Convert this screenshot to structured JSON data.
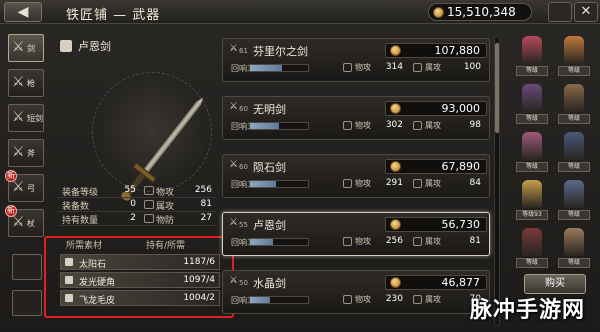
{
  "header": {
    "back_label": "◀",
    "title": "铁匠铺 — 武器",
    "money": "15,510,348",
    "close_label": "✕"
  },
  "tabs": [
    {
      "label": "剑",
      "icon": "sword-icon",
      "active": true
    },
    {
      "label": "枪",
      "icon": "spear-icon"
    },
    {
      "label": "短剑",
      "icon": "dagger-icon"
    },
    {
      "label": "斧",
      "icon": "axe-icon"
    },
    {
      "label": "弓",
      "icon": "bow-icon",
      "badge": "新"
    },
    {
      "label": "杖",
      "icon": "staff-icon",
      "badge": "新"
    }
  ],
  "detail": {
    "weapon_name": "卢恩剑",
    "stats": [
      {
        "label": "装备等级",
        "value": "55",
        "label2": "物攻",
        "value2": "256"
      },
      {
        "label": "装备数",
        "value": "0",
        "label2": "属攻",
        "value2": "81"
      },
      {
        "label": "持有数量",
        "value": "2",
        "label2": "物防",
        "value2": "27"
      }
    ],
    "materials_header": [
      "所需素材",
      "持有/所需"
    ],
    "materials": [
      {
        "name": "太阳石",
        "qty": "1187/6"
      },
      {
        "name": "发光硬角",
        "qty": "1097/4"
      },
      {
        "name": "飞龙毛皮",
        "qty": "1004/2"
      }
    ]
  },
  "weapons": [
    {
      "level": "61",
      "name": "芬里尔之剑",
      "price": "107,880",
      "rate_label": "回响3",
      "rate": 0.55,
      "atk": "314",
      "elem": "100"
    },
    {
      "level": "60",
      "name": "无明剑",
      "price": "93,000",
      "rate_label": "回响3",
      "rate": 0.5,
      "atk": "302",
      "elem": "98"
    },
    {
      "level": "60",
      "name": "陨石剑",
      "price": "67,890",
      "rate_label": "回响3",
      "rate": 0.45,
      "atk": "291",
      "elem": "84"
    },
    {
      "level": "55",
      "name": "卢恩剑",
      "price": "56,730",
      "rate_label": "回响3",
      "rate": 0.4,
      "atk": "256",
      "elem": "81",
      "selected": true
    },
    {
      "level": "50",
      "name": "水晶剑",
      "price": "46,877",
      "rate_label": "回响3",
      "rate": 0.35,
      "atk": "230",
      "elem": "70"
    }
  ],
  "labels": {
    "atk": "物攻",
    "elem": "属攻"
  },
  "party": [
    {
      "tag": "等级",
      "color": "#b84a5a"
    },
    {
      "tag": "等级",
      "color": "#c07a3a"
    },
    {
      "tag": "等级",
      "color": "#6a4a7a"
    },
    {
      "tag": "等级",
      "color": "#8a6a4a"
    },
    {
      "tag": "等级",
      "color": "#a05a7a"
    },
    {
      "tag": "等级",
      "color": "#4a5a7a"
    },
    {
      "tag": "等级93",
      "color": "#c8a04a"
    },
    {
      "tag": "等级",
      "color": "#5a6a8a"
    },
    {
      "tag": "等级",
      "color": "#7a3a3a"
    },
    {
      "tag": "等级",
      "color": "#9a7a5a"
    }
  ],
  "buy_label": "购买",
  "watermark": "脉冲手游网"
}
